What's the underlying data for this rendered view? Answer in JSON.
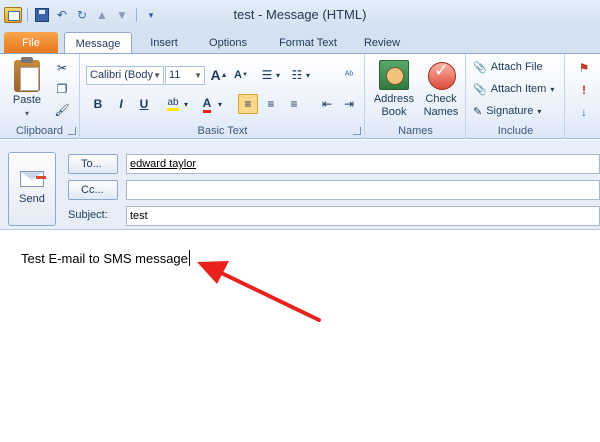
{
  "window": {
    "title": "test  -  Message (HTML)"
  },
  "quick_access": [
    "app-icon",
    "save-icon",
    "undo-icon",
    "redo-icon",
    "up-arrow-icon",
    "down-arrow-icon",
    "customize-icon"
  ],
  "tabs": {
    "file": "File",
    "items": [
      "Message",
      "Insert",
      "Options",
      "Format Text",
      "Review"
    ],
    "active": "Message"
  },
  "ribbon": {
    "clipboard": {
      "label": "Clipboard",
      "paste": "Paste"
    },
    "basic_text": {
      "label": "Basic Text",
      "font_name": "Calibri (Body",
      "font_size": "11",
      "grow": "A",
      "shrink": "A",
      "bold": "B",
      "italic": "I",
      "underline": "U",
      "highlight": "ab",
      "font_color": "A"
    },
    "names": {
      "label": "Names",
      "address_book": "Address Book",
      "check_names": "Check Names"
    },
    "include": {
      "label": "Include",
      "attach_file": "Attach File",
      "attach_item": "Attach Item",
      "signature": "Signature"
    }
  },
  "compose": {
    "send": "Send",
    "to_button": "To...",
    "cc_button": "Cc...",
    "to_value": "edward taylor",
    "cc_value": "",
    "subject_label": "Subject:",
    "subject_value": "test",
    "body": "Test E-mail to SMS message"
  },
  "colors": {
    "file_tab": "#e7761e",
    "ribbon_bg": "#e9f0fa",
    "annotation_arrow": "#e8211c",
    "header_panel": "#e7eef8"
  }
}
